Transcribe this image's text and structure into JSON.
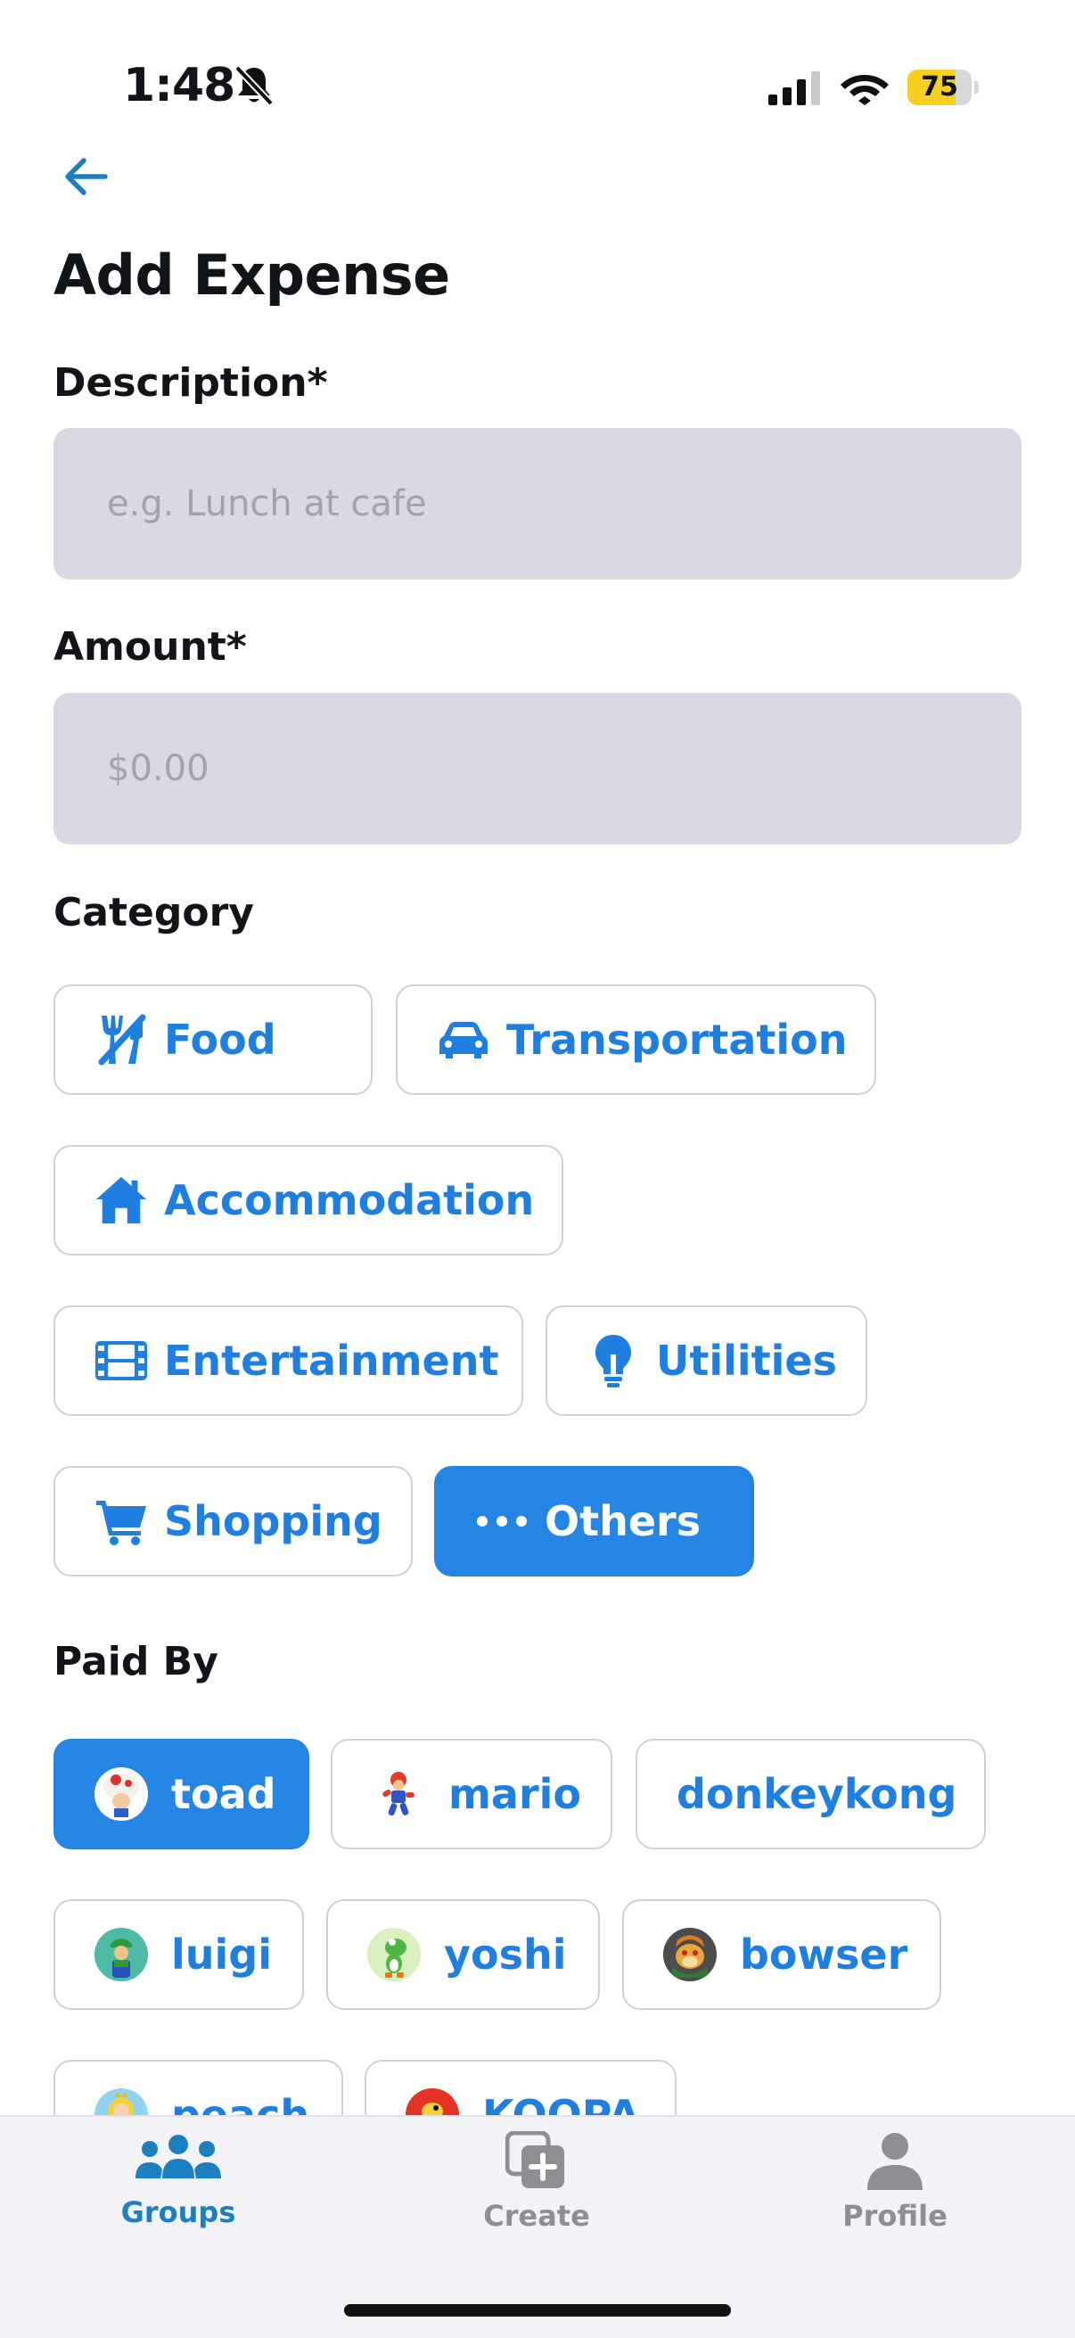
{
  "status_bar": {
    "time": "1:48",
    "battery": "75",
    "battery_level": 0.75
  },
  "header": {
    "title": "Add Expense"
  },
  "form": {
    "description": {
      "label": "Description*",
      "placeholder": "e.g. Lunch at cafe",
      "value": ""
    },
    "amount": {
      "label": "Amount*",
      "placeholder": "$0.00",
      "value": ""
    },
    "category": {
      "label": "Category",
      "items": [
        {
          "label": "Food",
          "icon": "utensils-icon",
          "selected": false
        },
        {
          "label": "Transportation",
          "icon": "car-icon",
          "selected": false
        },
        {
          "label": "Accommodation",
          "icon": "house-icon",
          "selected": false
        },
        {
          "label": "Entertainment",
          "icon": "film-icon",
          "selected": false
        },
        {
          "label": "Utilities",
          "icon": "lightbulb-icon",
          "selected": false
        },
        {
          "label": "Shopping",
          "icon": "cart-icon",
          "selected": false
        },
        {
          "label": "Others",
          "icon": "ellipsis-icon",
          "selected": true
        }
      ]
    },
    "paid_by": {
      "label": "Paid By",
      "members": [
        {
          "name": "toad",
          "avatar": "toad-avatar",
          "selected": true
        },
        {
          "name": "mario",
          "avatar": "mario-avatar",
          "selected": false
        },
        {
          "name": "donkeykong",
          "avatar": "",
          "selected": false
        },
        {
          "name": "luigi",
          "avatar": "luigi-avatar",
          "selected": false
        },
        {
          "name": "yoshi",
          "avatar": "yoshi-avatar",
          "selected": false
        },
        {
          "name": "bowser",
          "avatar": "bowser-avatar",
          "selected": false
        },
        {
          "name": "peach",
          "avatar": "peach-avatar",
          "selected": false
        },
        {
          "name": "KOOPA",
          "avatar": "koopa-avatar",
          "selected": false
        }
      ]
    }
  },
  "bottom_nav": {
    "items": [
      {
        "label": "Groups",
        "icon": "people-icon",
        "active": true
      },
      {
        "label": "Create",
        "icon": "create-icon",
        "active": false
      },
      {
        "label": "Profile",
        "icon": "person-icon",
        "active": false
      }
    ]
  },
  "colors": {
    "accent": "#2485e4",
    "chip_text": "#1f7fe0",
    "input_bg": "#d9d8e3",
    "nav_active": "#1c7fc0",
    "nav_inactive": "#8e8e93"
  }
}
